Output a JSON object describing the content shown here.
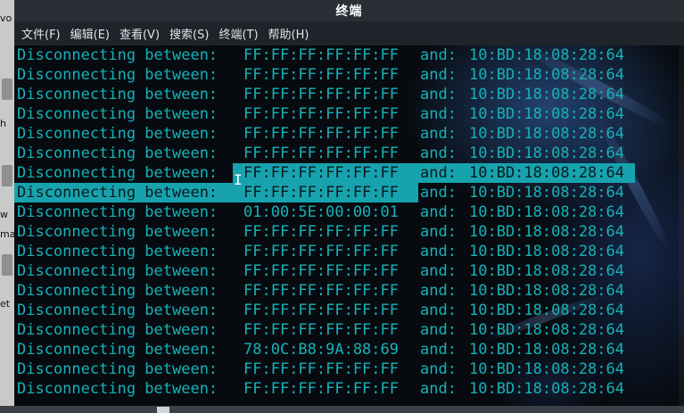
{
  "window": {
    "title": "终端"
  },
  "menu": [
    {
      "label": "文件(F)"
    },
    {
      "label": "编辑(E)"
    },
    {
      "label": "查看(V)"
    },
    {
      "label": "搜索(S)"
    },
    {
      "label": "终端(T)"
    },
    {
      "label": "帮助(H)"
    }
  ],
  "terminal": {
    "lines": [
      {
        "prefix": "Disconnecting between:",
        "mac1": "FF:FF:FF:FF:FF:FF",
        "and": "and:",
        "mac2": "10:BD:18:08:28:64"
      },
      {
        "prefix": "Disconnecting between:",
        "mac1": "FF:FF:FF:FF:FF:FF",
        "and": "and:",
        "mac2": "10:BD:18:08:28:64"
      },
      {
        "prefix": "Disconnecting between:",
        "mac1": "FF:FF:FF:FF:FF:FF",
        "and": "and:",
        "mac2": "10:BD:18:08:28:64"
      },
      {
        "prefix": "Disconnecting between:",
        "mac1": "FF:FF:FF:FF:FF:FF",
        "and": "and:",
        "mac2": "10:BD:18:08:28:64"
      },
      {
        "prefix": "Disconnecting between:",
        "mac1": "FF:FF:FF:FF:FF:FF",
        "and": "and:",
        "mac2": "10:BD:18:08:28:64"
      },
      {
        "prefix": "Disconnecting between:",
        "mac1": "FF:FF:FF:FF:FF:FF",
        "and": "and:",
        "mac2": "10:BD:18:08:28:64"
      },
      {
        "prefix": "Disconnecting between:",
        "mac1": "FF:FF:FF:FF:FF:FF",
        "and": "and:",
        "mac2": "10:BD:18:08:28:64",
        "selected": "rest"
      },
      {
        "prefix": "Disconnecting between:",
        "mac1": "FF:FF:FF:FF:FF:FF",
        "and": "and:",
        "mac2": "10:BD:18:08:28:64",
        "selected": "start"
      },
      {
        "prefix": "Disconnecting between:",
        "mac1": "01:00:5E:00:00:01",
        "and": "and:",
        "mac2": "10:BD:18:08:28:64"
      },
      {
        "prefix": "Disconnecting between:",
        "mac1": "FF:FF:FF:FF:FF:FF",
        "and": "and:",
        "mac2": "10:BD:18:08:28:64"
      },
      {
        "prefix": "Disconnecting between:",
        "mac1": "FF:FF:FF:FF:FF:FF",
        "and": "and:",
        "mac2": "10:BD:18:08:28:64"
      },
      {
        "prefix": "Disconnecting between:",
        "mac1": "FF:FF:FF:FF:FF:FF",
        "and": "and:",
        "mac2": "10:BD:18:08:28:64"
      },
      {
        "prefix": "Disconnecting between:",
        "mac1": "FF:FF:FF:FF:FF:FF",
        "and": "and:",
        "mac2": "10:BD:18:08:28:64"
      },
      {
        "prefix": "Disconnecting between:",
        "mac1": "FF:FF:FF:FF:FF:FF",
        "and": "and:",
        "mac2": "10:BD:18:08:28:64"
      },
      {
        "prefix": "Disconnecting between:",
        "mac1": "FF:FF:FF:FF:FF:FF",
        "and": "and:",
        "mac2": "10:BD:18:08:28:64"
      },
      {
        "prefix": "Disconnecting between:",
        "mac1": "78:0C:B8:9A:88:69",
        "and": "and:",
        "mac2": "10:BD:18:08:28:64"
      },
      {
        "prefix": "Disconnecting between:",
        "mac1": "FF:FF:FF:FF:FF:FF",
        "and": "and:",
        "mac2": "10:BD:18:08:28:64"
      },
      {
        "prefix": "Disconnecting between:",
        "mac1": "FF:FF:FF:FF:FF:FF",
        "and": "and:",
        "mac2": "10:BD:18:08:28:64"
      }
    ]
  },
  "desktop_fragments": [
    "vo",
    "h",
    "w",
    "ma",
    "et"
  ],
  "colors": {
    "text": "#16b2b8",
    "selection": "#17a3ae",
    "titlebar": "#2a2f35",
    "menubar": "#1f242a"
  },
  "icons": {
    "cursor": "text-cursor-icon"
  }
}
